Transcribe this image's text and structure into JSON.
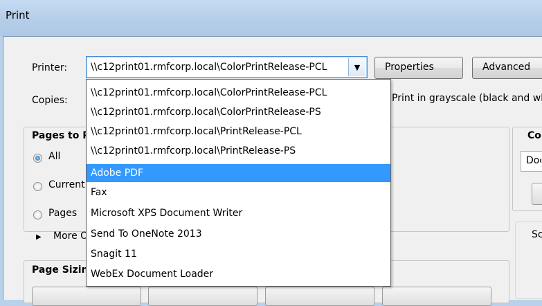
{
  "window": {
    "title": "Print"
  },
  "printer": {
    "label": "Printer:",
    "selected": "\\\\c12print01.rmfcorp.local\\ColorPrintRelease-PCL",
    "properties_label": "Properties",
    "advanced_label": "Advanced"
  },
  "copies": {
    "label": "Copies:",
    "grayscale_label": "Print in grayscale (black and white)"
  },
  "pages": {
    "title": "Pages to Print",
    "all_label": "All",
    "current_label": "Current page",
    "pages_label": "Pages",
    "more_label": "More Options"
  },
  "page_sizing": {
    "title": "Page Sizing & Handling"
  },
  "right_panel": {
    "group_title": "Comments & Forms",
    "select_value": "Document and Markups",
    "scale_label": "Scale"
  },
  "dropdown": {
    "items": [
      "\\\\c12print01.rmfcorp.local\\ColorPrintRelease-PCL",
      "\\\\c12print01.rmfcorp.local\\ColorPrintRelease-PS",
      "\\\\c12print01.rmfcorp.local\\PrintRelease-PCL",
      "\\\\c12print01.rmfcorp.local\\PrintRelease-PS",
      "Adobe PDF",
      "Fax",
      "Microsoft XPS Document Writer",
      "Send To OneNote 2013",
      "Snagit 11",
      "WebEx Document Loader"
    ],
    "selected_index": 4
  },
  "icons": {
    "combo_arrow": "chevron-down-icon",
    "more_options": "triangle-right-icon"
  }
}
